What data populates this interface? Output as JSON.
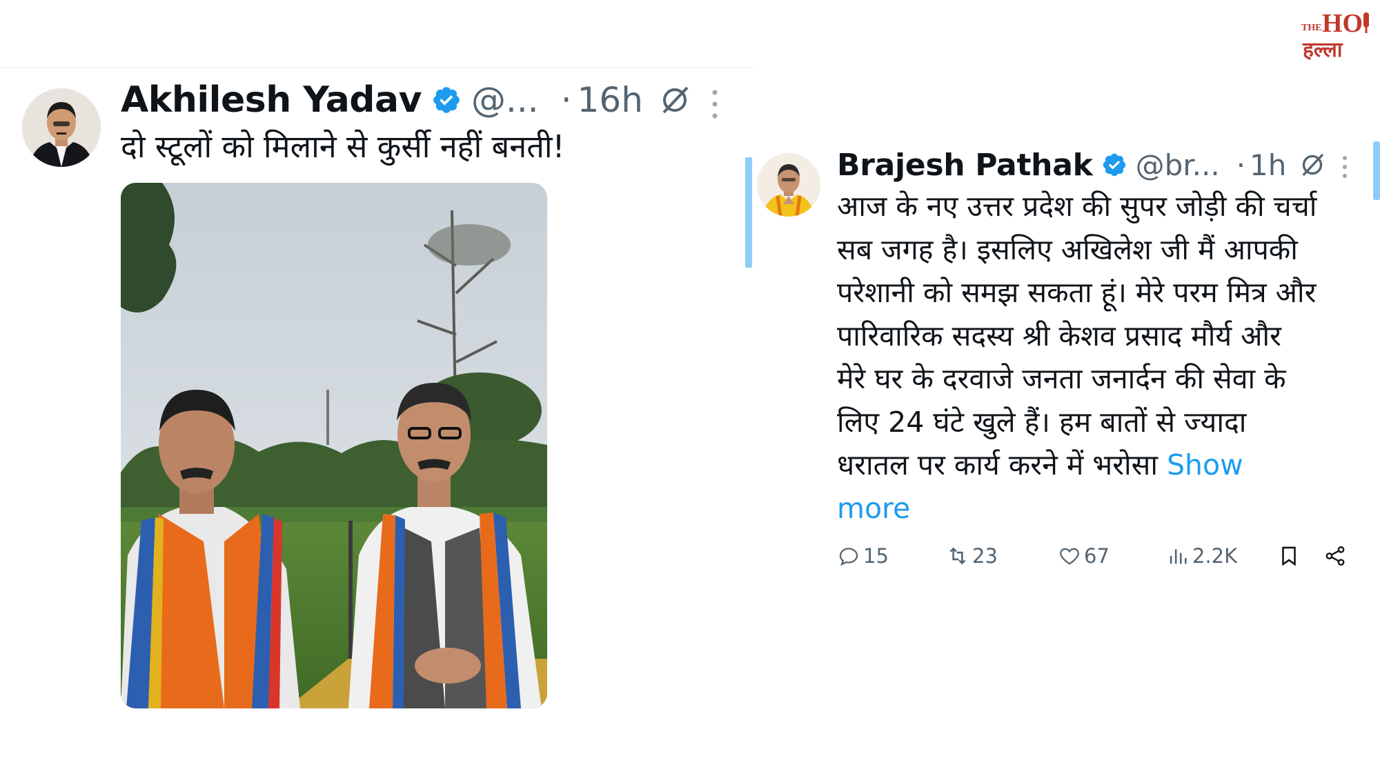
{
  "logo": {
    "small": "THE",
    "main": "HO",
    "sub": "हल्ला",
    "color": "#c0392b"
  },
  "left_tweet": {
    "author": "Akhilesh Yadav",
    "handle": "@...",
    "dot": "·",
    "time": "16h",
    "text": "दो स्टूलों को मिलाने से कुर्सी नहीं बनती!",
    "verified": true,
    "icons": [
      "verified-badge-icon",
      "grok-icon",
      "more-icon"
    ]
  },
  "right_tweet": {
    "author": "Brajesh Pathak",
    "handle": "@br...",
    "dot": "·",
    "time": "1h",
    "verified": true,
    "text_lines": [
      "आज के नए उत्तर प्रदेश की सुपर जोड़ी की चर्चा",
      "सब जगह है। इसलिए अखिलेश जी मैं आपकी",
      "परेशानी को समझ सकता हूं। मेरे परम मित्र और",
      "पारिवारिक सदस्य श्री केशव प्रसाद मौर्य और",
      "मेरे घर के दरवाजे जनता जनार्दन की सेवा के",
      "लिए 24 घंटे खुले हैं। हम बातों से ज्यादा",
      "धरातल पर कार्य करने में भरोसा"
    ],
    "show_more": [
      "Show",
      "more"
    ],
    "actions": {
      "replies": "15",
      "reposts": "23",
      "likes": "67",
      "views": "2.2K"
    }
  },
  "colors": {
    "verified": "#1d9bf0",
    "link": "#1d9bf0",
    "secondary_text": "#536471",
    "thread_line": "#8ecdf8"
  }
}
